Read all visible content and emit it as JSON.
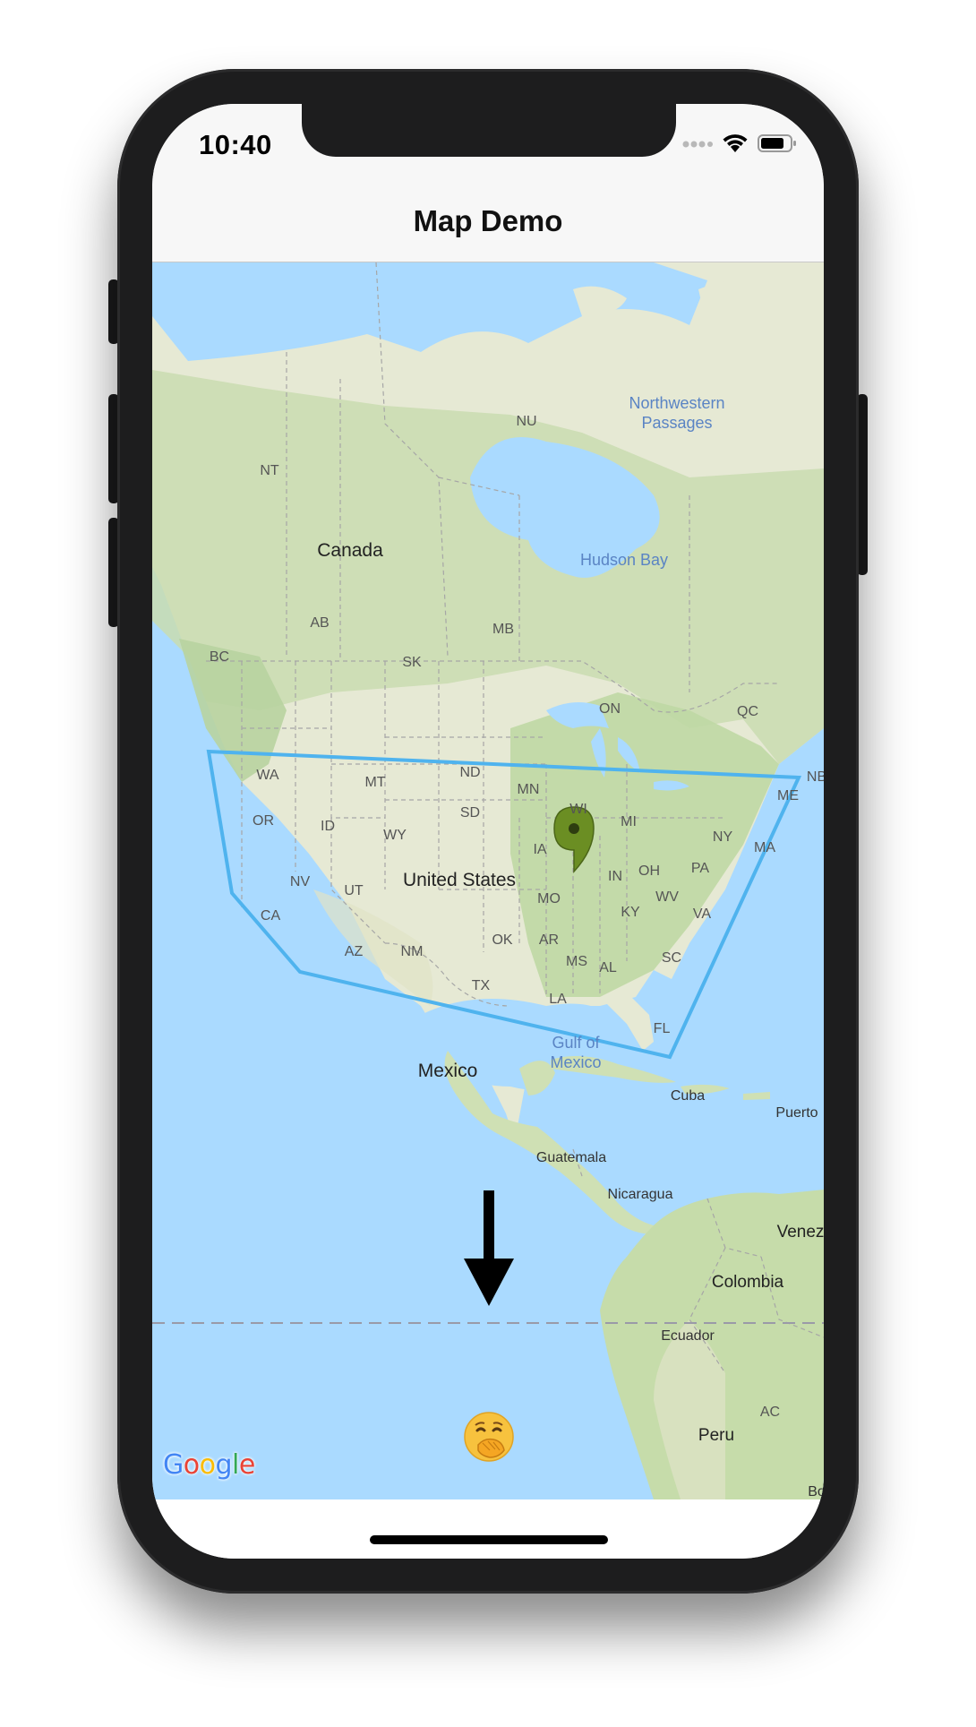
{
  "status_bar": {
    "time": "10:40",
    "icons": [
      "signal-dots-icon",
      "wifi-icon",
      "battery-icon"
    ]
  },
  "nav": {
    "title": "Map Demo"
  },
  "map": {
    "provider_logo": "Google",
    "logo_letters": [
      "G",
      "o",
      "o",
      "g",
      "l",
      "e"
    ],
    "logo_colors": [
      "#4285F4",
      "#EA4335",
      "#FBBC05",
      "#4285F4",
      "#34A853",
      "#EA4335"
    ],
    "countries": {
      "canada": "Canada",
      "us": "United States",
      "mexico": "Mexico",
      "cuba": "Cuba",
      "puerto": "Puerto",
      "guatemala": "Guatemala",
      "nicaragua": "Nicaragua",
      "venez": "Venez",
      "colombia": "Colombia",
      "ecuador": "Ecuador",
      "peru": "Peru",
      "bo": "Bo"
    },
    "water": {
      "northwestern": "Northwestern Passages",
      "hudson": "Hudson Bay",
      "gulf": "Gulf of Mexico"
    },
    "regions": {
      "nu": "NU",
      "nt": "NT",
      "ab": "AB",
      "mb": "MB",
      "sk": "SK",
      "bc": "BC",
      "on": "ON",
      "qc": "QC",
      "nb": "NB",
      "wa": "WA",
      "mt": "MT",
      "nd": "ND",
      "mn": "MN",
      "wi": "WI",
      "mi": "MI",
      "me": "ME",
      "or": "OR",
      "id": "ID",
      "sd": "SD",
      "wy": "WY",
      "ia": "IA",
      "ny": "NY",
      "ma": "MA",
      "nv": "NV",
      "ut": "UT",
      "in": "IN",
      "oh": "OH",
      "pa": "PA",
      "ca": "CA",
      "mo": "MO",
      "ky": "KY",
      "wv": "WV",
      "va": "VA",
      "az": "AZ",
      "nm": "NM",
      "ok": "OK",
      "ar": "AR",
      "sc": "SC",
      "ms": "MS",
      "al": "AL",
      "tx": "TX",
      "la": "LA",
      "fl": "FL",
      "ac": "AC"
    },
    "overlay_colors": {
      "polygon_stroke": "#4fb3ee",
      "marker_fill": "#6b8e23",
      "equator_line": "#9a9aa8",
      "arrow": "#000000"
    },
    "emoji_marker": "face-with-hand-over-mouth-icon"
  }
}
